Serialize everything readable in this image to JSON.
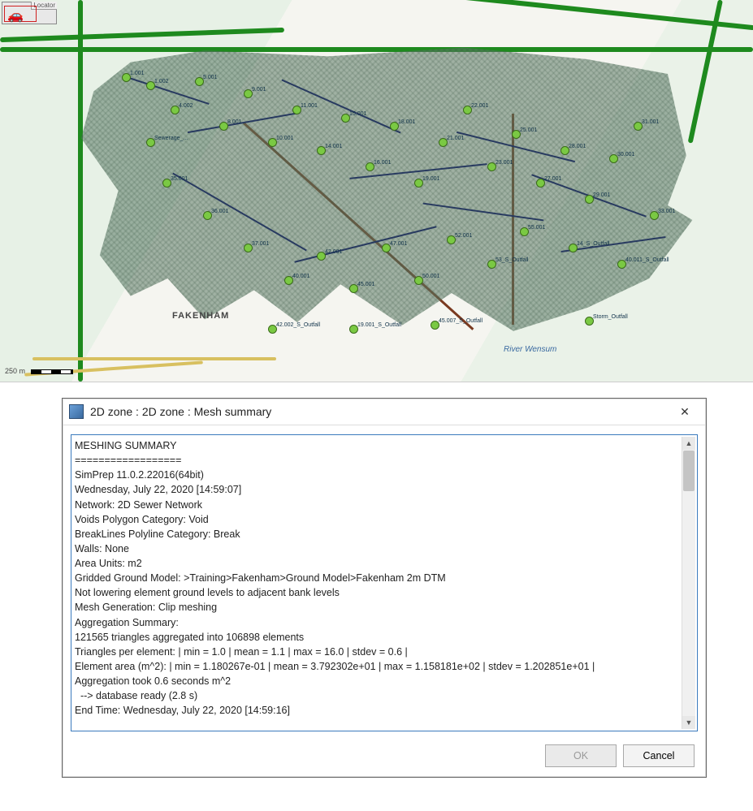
{
  "map": {
    "locator_label": "Locator",
    "scale_label": "250 m",
    "town_label": "FAKENHAM",
    "river_label": "River Wensum",
    "sample_node_labels": [
      "1.001",
      "1.002",
      "4.002",
      "5.001",
      "8.001",
      "9.001",
      "10.001",
      "11.001",
      "14.001",
      "15.001",
      "16.001",
      "18.001",
      "19.001",
      "21.001",
      "22.001",
      "23.001",
      "25.001",
      "27.001",
      "28.001",
      "29.001",
      "30.001",
      "31.001",
      "33.001",
      "35.001",
      "36.001",
      "37.001",
      "40.001",
      "42.001",
      "45.001",
      "47.001",
      "50.001",
      "52.001",
      "53_S_Outfall",
      "55.001",
      "14_S_Outfall",
      "40.011_S_Outfall",
      "42.002_S_Outfall",
      "19.001_S_Outfall",
      "45.007_S_Outfall",
      "Storm_Outfall",
      "Sewerage_..."
    ]
  },
  "dialog": {
    "title": "2D zone : 2D zone : Mesh summary",
    "lines": [
      "MESHING SUMMARY",
      "==================",
      "SimPrep 11.0.2.22016(64bit)",
      "Wednesday, July 22, 2020 [14:59:07]",
      "Network: 2D Sewer Network",
      "Voids Polygon Category: Void",
      "BreakLines Polyline Category: Break",
      "Walls: None",
      "Area Units: m2",
      "Gridded Ground Model: >Training>Fakenham>Ground Model>Fakenham 2m DTM",
      "Not lowering element ground levels to adjacent bank levels",
      "Mesh Generation: Clip meshing",
      "Aggregation Summary:",
      "121565 triangles aggregated into 106898 elements",
      "Triangles per element: | min = 1.0 | mean = 1.1 | max = 16.0 | stdev = 0.6 |",
      "Element area (m^2): | min = 1.180267e-01 | mean = 3.792302e+01 | max = 1.158181e+02 | stdev = 1.202851e+01 |",
      "Aggregation took 0.6 seconds m^2",
      "  --> database ready (2.8 s)",
      "End Time: Wednesday, July 22, 2020 [14:59:16]"
    ],
    "buttons": {
      "ok": "OK",
      "cancel": "Cancel"
    }
  }
}
